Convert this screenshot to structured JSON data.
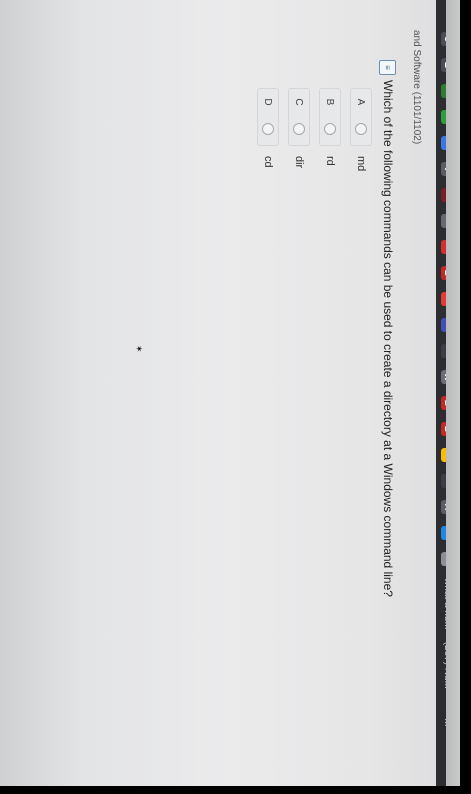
{
  "browser": {
    "bookmarks": [
      {
        "name": "o-icon",
        "label": "O",
        "color": "#4a4d54"
      },
      {
        "name": "z-icon",
        "label": "Z",
        "color": "#4a4d54"
      },
      {
        "name": "leaf-icon",
        "label": "",
        "color": "#2e7d32"
      },
      {
        "name": "green-square-icon",
        "label": "",
        "color": "#2e9d3e"
      },
      {
        "name": "chrome-icon",
        "label": "",
        "color": "#3b78e7"
      },
      {
        "name": "circle-v-icon",
        "label": "V",
        "color": "#5a5d64"
      },
      {
        "name": "grid-icon",
        "label": "",
        "color": "#7a1f2a"
      },
      {
        "name": "gray-square-icon",
        "label": "",
        "color": "#66696f"
      },
      {
        "name": "red-dot-icon",
        "label": "",
        "color": "#d32f2f"
      },
      {
        "name": "b-red-icon",
        "label": "B",
        "color": "#c62828"
      },
      {
        "name": "youtube-icon",
        "label": "",
        "color": "#e53935"
      },
      {
        "name": "mail-icon",
        "label": "",
        "color": "#3f51b5"
      },
      {
        "name": "music-icon",
        "label": "",
        "color": "#3a3d44"
      },
      {
        "name": "w-icon",
        "label": "W",
        "color": "#6b6e75"
      },
      {
        "name": "b-red-icon-2",
        "label": "B",
        "color": "#c62828"
      },
      {
        "name": "b-red-icon-3",
        "label": "B",
        "color": "#c62828"
      },
      {
        "name": "google-icon",
        "label": "",
        "color": "#fbbc05"
      },
      {
        "name": "dark-square-icon",
        "label": "",
        "color": "#3a3d44"
      },
      {
        "name": "a-icon",
        "label": "A",
        "color": "#5a5d64"
      },
      {
        "name": "blue-circle-icon",
        "label": "",
        "color": "#1e88e5"
      },
      {
        "name": "image-icon",
        "label": "",
        "color": "#8d8f94"
      }
    ],
    "bookmark_texts": [
      "what a nu...",
      "(2e7) Nu...",
      "+ + ..."
    ]
  },
  "course": {
    "title": "and Software (1101/1102)"
  },
  "question": {
    "text": "Which of the following commands can be used to create a directory at a Windows command line?"
  },
  "options": [
    {
      "letter": "A",
      "text": "md"
    },
    {
      "letter": "B",
      "text": "rd"
    },
    {
      "letter": "C",
      "text": "dir"
    },
    {
      "letter": "D",
      "text": "cd"
    }
  ]
}
